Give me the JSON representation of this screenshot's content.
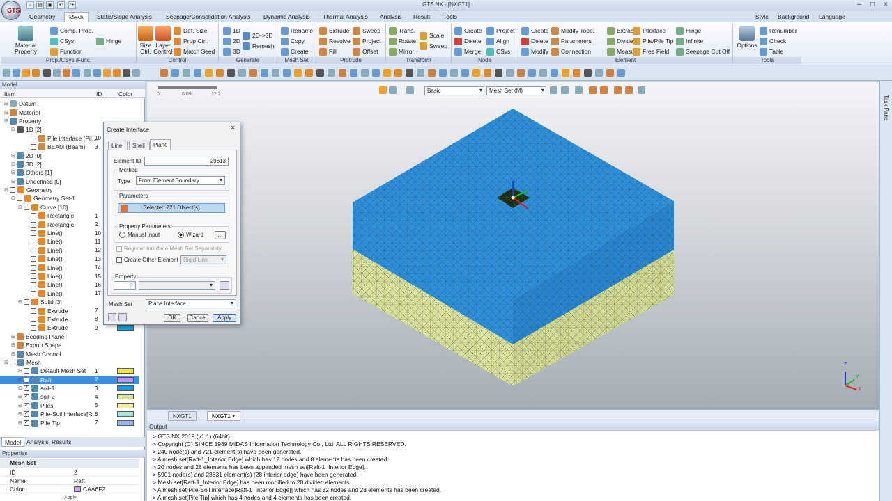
{
  "app": {
    "title": "GTS NX - [NXGT1]"
  },
  "quick_access": {
    "icons": [
      "new-icon",
      "open-icon",
      "save-icon",
      "undo-icon",
      "redo-icon"
    ]
  },
  "menu": {
    "tabs": [
      "Geometry",
      "Mesh",
      "Static/Slope Analysis",
      "Seepage/Consolidation Analysis",
      "Dynamic Analysis",
      "Thermal Analysis",
      "Analysis",
      "Result",
      "Tools"
    ],
    "active_tab": "Mesh",
    "right": [
      "Style",
      "Background",
      "Language"
    ]
  },
  "ribbon": {
    "groups": [
      {
        "label": "Prop./CSys./Func.",
        "big": [
          "Material Property"
        ],
        "items": [
          "Comp. Prop.",
          "CSys",
          "Function",
          "Hinge"
        ]
      },
      {
        "label": "Control",
        "big": [
          "Size Ctrl.",
          "Layer Control"
        ],
        "items": [
          "Def. Size",
          "Prop Ctrl.",
          "Match Seed"
        ]
      },
      {
        "label": "Generate",
        "items": [
          "1D",
          "2D",
          "3D",
          "2D->3D",
          "Remesh"
        ]
      },
      {
        "label": "Mesh Set",
        "items": [
          "Rename",
          "Copy",
          "Create"
        ]
      },
      {
        "label": "Protrude",
        "items": [
          "Extrude",
          "Revolve",
          "Fill",
          "Sweep",
          "Project",
          "Offset"
        ]
      },
      {
        "label": "Transform",
        "items": [
          "Trans.",
          "Rotate",
          "Mirror",
          "Scale",
          "Sweep"
        ]
      },
      {
        "label": "Node",
        "items": [
          "Create",
          "Delete",
          "Merge",
          "Project",
          "Align",
          "CSys"
        ]
      },
      {
        "label": "Element",
        "items": [
          "Create",
          "Delete",
          "Modify",
          "Modify Topo.",
          "Parameters",
          "Connection",
          "Extract",
          "Divide",
          "Measure",
          "Interface",
          "Pile/Pile Tip",
          "Free Field",
          "Hinge",
          "Infinite",
          "Seepage Cut Off"
        ]
      },
      {
        "label": "Tools",
        "big": [
          "Options"
        ],
        "items": [
          "Renumber",
          "Check",
          "Table"
        ]
      }
    ]
  },
  "model_panel": {
    "title": "Model",
    "columns": [
      "Item",
      "ID",
      "Color"
    ],
    "tree": [
      {
        "label": "Datum",
        "id": "",
        "color": ""
      },
      {
        "label": "Material",
        "id": "",
        "color": ""
      },
      {
        "label": "Property",
        "id": "",
        "color": ""
      },
      {
        "label": "1D [2]",
        "id": "",
        "color": ""
      },
      {
        "label": "Pile interface (Pil...",
        "id": "10",
        "color": ""
      },
      {
        "label": "BEAM (Beam)",
        "id": "3",
        "color": ""
      },
      {
        "label": "2D [0]",
        "id": "",
        "color": ""
      },
      {
        "label": "3D [2]",
        "id": "",
        "color": ""
      },
      {
        "label": "Others [1]",
        "id": "",
        "color": ""
      },
      {
        "label": "Undefined [0]",
        "id": "",
        "color": ""
      },
      {
        "label": "Geometry",
        "id": "",
        "color": ""
      },
      {
        "label": "Geometry Set-1",
        "id": "",
        "color": ""
      },
      {
        "label": "Curve [10]",
        "id": "",
        "color": ""
      },
      {
        "label": "Rectangle",
        "id": "1",
        "color": ""
      },
      {
        "label": "Rectangle",
        "id": "2",
        "color": ""
      },
      {
        "label": "Line()",
        "id": "10",
        "color": ""
      },
      {
        "label": "Line()",
        "id": "11",
        "color": ""
      },
      {
        "label": "Line()",
        "id": "12",
        "color": ""
      },
      {
        "label": "Line()",
        "id": "13",
        "color": ""
      },
      {
        "label": "Line()",
        "id": "14",
        "color": ""
      },
      {
        "label": "Line()",
        "id": "15",
        "color": ""
      },
      {
        "label": "Line()",
        "id": "16",
        "color": ""
      },
      {
        "label": "Line()",
        "id": "17",
        "color": ""
      },
      {
        "label": "Solid [3]",
        "id": "",
        "color": ""
      },
      {
        "label": "Extrude",
        "id": "7",
        "color": ""
      },
      {
        "label": "Extrude",
        "id": "8",
        "color": ""
      },
      {
        "label": "Extrude",
        "id": "9",
        "color": "#1aa0d8"
      },
      {
        "label": "Bedding Plane",
        "id": "",
        "color": ""
      },
      {
        "label": "Export Shape",
        "id": "",
        "color": ""
      },
      {
        "label": "Mesh Control",
        "id": "",
        "color": ""
      },
      {
        "label": "Mesh",
        "id": "",
        "color": ""
      },
      {
        "label": "Default Mesh Set",
        "id": "1",
        "color": "#e8e84a"
      },
      {
        "label": "Raft",
        "id": "2",
        "color": "#b89ae8"
      },
      {
        "label": "soil-1",
        "id": "3",
        "color": "#1a9ad8"
      },
      {
        "label": "soil-2",
        "id": "4",
        "color": "#d8e890"
      },
      {
        "label": "Piles",
        "id": "5",
        "color": "#f0f0a0"
      },
      {
        "label": "Pile-Soil interface[R...",
        "id": "6",
        "color": "#a8e8e0"
      },
      {
        "label": "Pile Tip",
        "id": "7",
        "color": "#9ab8f0"
      }
    ],
    "tabs": [
      "Model",
      "Analysis",
      "Results"
    ]
  },
  "properties": {
    "title": "Properties",
    "section": "Mesh Set",
    "rows": [
      {
        "k": "ID",
        "v": "2"
      },
      {
        "k": "Name",
        "v": "Raft"
      },
      {
        "k": "Color",
        "v": "CAA6F2"
      }
    ],
    "color_hex": "#CAA6F2",
    "footer": "Apply"
  },
  "dialog": {
    "title": "Create Interface",
    "tabs": [
      "Line",
      "Shell",
      "Plane"
    ],
    "active_tab": "Plane",
    "element_id_label": "Element ID",
    "element_id": "29613",
    "method_label": "Method",
    "type_label": "Type",
    "type_value": "From Element Boundary",
    "parameters_label": "Parameters",
    "selected": "Selected 721 Object(s)",
    "prop_params_label": "Property Parameters",
    "manual_input": "Manual Input",
    "wizard": "Wizard",
    "more": "...",
    "register": "Register Interface Mesh Set Separately",
    "create_other": "Create Other Element",
    "rigid_link": "Rigid Link",
    "property_label": "Property",
    "property_value": "2",
    "mesh_set_label": "Mesh Set",
    "mesh_set_value": "Plane Interface",
    "ok": "OK",
    "cancel": "Cancel",
    "apply": "Apply"
  },
  "viewport": {
    "display_mode": "Basic",
    "mesh_set": "Mesh Set (M)",
    "ruler": [
      "0",
      "6.09",
      "12.2"
    ],
    "axes": [
      "Z",
      "Y",
      "X"
    ],
    "colors": {
      "top_soil": "#2f8fd8",
      "bottom_soil": "#d8e29a",
      "raft": "#1a2a10"
    }
  },
  "doc_tabs": [
    "NXGT1",
    "NXGT1"
  ],
  "side_tab": "Task Pane",
  "output": {
    "title": "Output",
    "lines": [
      "> GTS NX 2019 (v1.1) (64bit)",
      "> Copyright (C) SINCE 1989 MIDAS Information Technology Co., Ltd. ALL RIGHTS RESERVED.",
      "> 240 node(s) and 721 element(s) have been generated.",
      "> A mesh set[Raft-1_Interior Edge] which has 12 nodes and 8 elements has been created.",
      "> 20 nodes and 28 elements has been appended mesh set[Raft-1_Interior Edge].",
      "> 5901 node(s) and 28831 element(s) (28 interior edge) have been generated.",
      "> Mesh set[Raft-1_Interior Edge] has been modified to 28 divided elements.",
      "> A mesh set[Pile-Soil interface[Raft-1_Interior Edge]] which has 32 nodes and 28 elements has been created.",
      "> A mesh set[Pile Tip] which has 4 nodes and 4 elements has been created."
    ]
  }
}
